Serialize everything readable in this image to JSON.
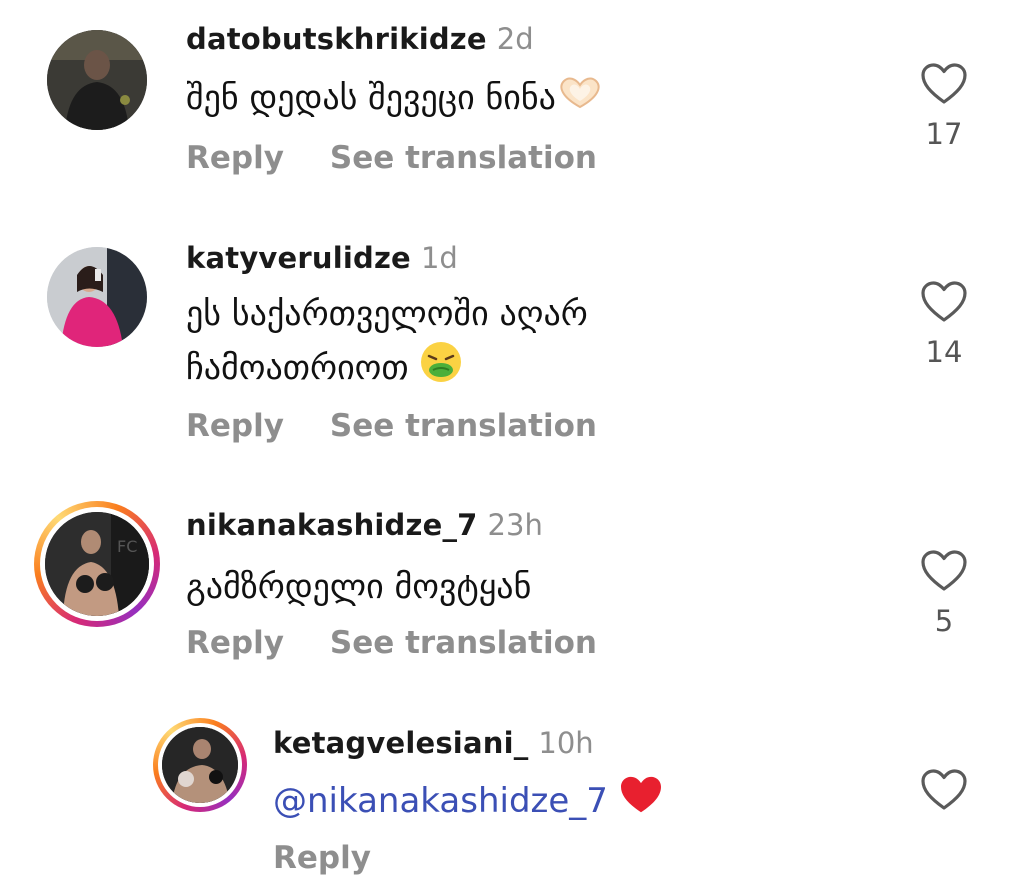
{
  "comments": [
    {
      "username": "datobutskhrikidze",
      "time": "2d",
      "text": "შენ დედას შევეცი ნინა",
      "emoji": "heart-hands",
      "reply": "Reply",
      "translate": "See translation",
      "likes": "17"
    },
    {
      "username": "katyverulidze",
      "time": "1d",
      "text_line1": "ეს საქართველოში აღარ",
      "text_line2": "ჩამოათრიოთ",
      "emoji": "vomiting-face",
      "reply": "Reply",
      "translate": "See translation",
      "likes": "14"
    },
    {
      "username": "nikanakashidze_7",
      "time": "23h",
      "text": "გამზრდელი მოვტყან",
      "reply": "Reply",
      "translate": "See translation",
      "likes": "5"
    },
    {
      "username": "ketagvelesiani_",
      "time": "10h",
      "mention": "@nikanakashidze_7",
      "emoji": "red-heart",
      "reply": "Reply",
      "likes": ""
    }
  ],
  "colors": {
    "username": "#1a1a1a",
    "secondary": "#8e8e8e",
    "mention": "#3b4fb5",
    "story_ring": [
      "#d62976",
      "#fa7e1e",
      "#feda75",
      "#962fbf"
    ]
  }
}
